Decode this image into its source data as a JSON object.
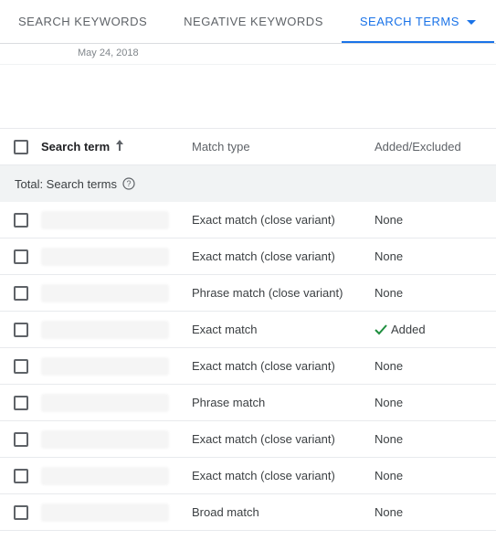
{
  "tabs": {
    "search_keywords": "SEARCH KEYWORDS",
    "negative_keywords": "NEGATIVE KEYWORDS",
    "search_terms": "SEARCH TERMS"
  },
  "date": "May 24, 2018",
  "headers": {
    "search_term": "Search term",
    "match_type": "Match type",
    "added_excluded": "Added/Excluded"
  },
  "totals_label": "Total: Search terms",
  "added_label": "Added",
  "rows": [
    {
      "match": "Exact match (close variant)",
      "added": "None"
    },
    {
      "match": "Exact match (close variant)",
      "added": "None"
    },
    {
      "match": "Phrase match (close variant)",
      "added": "None"
    },
    {
      "match": "Exact match",
      "added": "__added__"
    },
    {
      "match": "Exact match (close variant)",
      "added": "None"
    },
    {
      "match": "Phrase match",
      "added": "None"
    },
    {
      "match": "Exact match (close variant)",
      "added": "None"
    },
    {
      "match": "Exact match (close variant)",
      "added": "None"
    },
    {
      "match": "Broad match",
      "added": "None"
    }
  ]
}
